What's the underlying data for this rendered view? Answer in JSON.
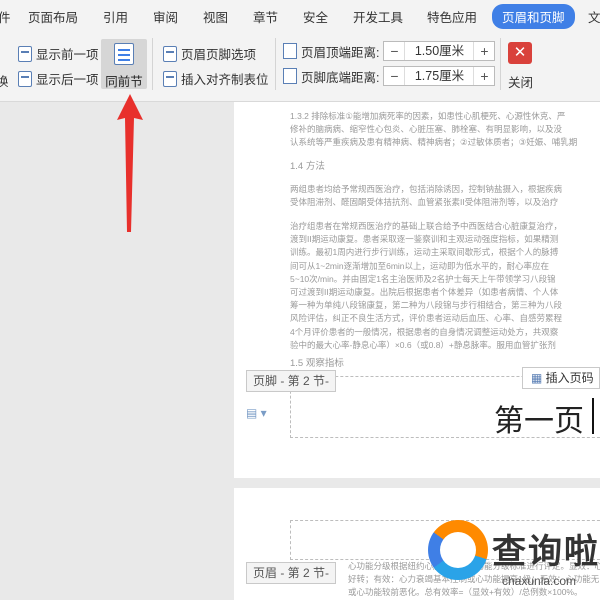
{
  "menubar": {
    "items": [
      "件",
      "页面布局",
      "引用",
      "审阅",
      "视图",
      "章节",
      "安全",
      "开发工具",
      "特色应用",
      "页眉和页脚",
      "文"
    ]
  },
  "ribbon": {
    "left_cut_label": "换",
    "show_prev": "显示前一项",
    "show_next": "显示后一项",
    "same_as_prev": "同前节",
    "hf_options": "页眉页脚选项",
    "insert_tab": "插入对齐制表位",
    "header_top_label": "页眉顶端距离:",
    "header_top_value": "1.50厘米",
    "footer_bottom_label": "页脚底端距离:",
    "footer_bottom_value": "1.75厘米",
    "close_label": "关闭"
  },
  "document": {
    "para_lines_1": [
      "1.3.2 排除标准①能增加病死率的因素，如患性心肌梗死、心源性休克、严",
      "修补的脑病病、缩窄性心包炎、心脏压塞、肺栓塞、有明显影响，以及没",
      "认系统等严重疾病及患有精神病、精神病者；②过敏体质者；③妊娠、哺乳期"
    ],
    "section_14": "1.4 方法",
    "para_lines_2": [
      "两组患者均给予常规西医治疗，包括消除诱因，控制钠盐摄入，根据疾病",
      "受体阻滞剂、醛固酮受体拮抗剂、血管紧张素II受体阻滞剂等，以及治疗"
    ],
    "para_lines_3": [
      "治疗组患者在常规西医治疗的基础上联合给予中西医结合心脏康复治疗，",
      "渡到II期运动康复。患者采取逐一鉴察训和主观运动强度指标，如果精测",
      "训练。最初1周内进行步行训练，运动主采取间歇形式，根据个人的脉搏",
      "间可从1~2min逐渐增加至6min以上，运动即为低水平的，耐心率应在",
      "5~10次/min。并由固定1名主治医师及2名护士每天上午带领学习八段锦",
      "可过渡到II期运动康复。出院后根据患者个体差异（如患者病情、个人体",
      "筹一种为单纯八段锦康复，第二种为八段锦与步行相结合，第三种为八段",
      "风险评估，纠正不良生活方式，评价患者运动后血压、心率、自感劳累程",
      "4个月评价患者的一般情况，根据患者的自身情况调整运动处方，共观察",
      "验中的最大心率-静息心率）×0.6（或0.8）+静息脉率。服用血管扩张剂"
    ],
    "section_15": "1.5 观察指标",
    "footer_tag": "页脚 - 第 2 节-",
    "insert_page_num": "插入页码",
    "page_number_text": "第一页",
    "header_tag": "页眉 - 第 2 节-",
    "para_lines_4": [
      "心功能分级根据纽约心脏病学会心功能分级标准进行评定。显效：心",
      "好转；有效：心力衰竭基本控制或心功能提高1级；无效：心功能无",
      "或心功能较前恶化。总有效率=（显效+有效）/总例数×100%。"
    ]
  },
  "watermark": {
    "text": "查询啦",
    "url": "chaxunla.com"
  },
  "colors": {
    "accent": "#3f7fe6",
    "close_red": "#d9413b",
    "arrow_red": "#e8302c"
  }
}
